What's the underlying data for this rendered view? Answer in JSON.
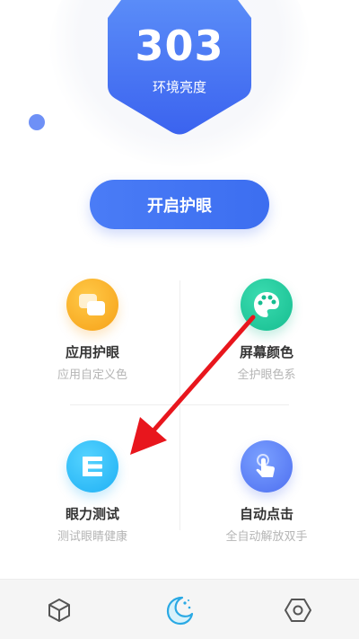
{
  "header": {
    "brightness_value": "303",
    "brightness_label": "环境亮度"
  },
  "main_button": {
    "label": "开启护眼"
  },
  "features": [
    {
      "title": "应用护眼",
      "subtitle": "应用自定义色",
      "icon": "app-eye-icon"
    },
    {
      "title": "屏幕颜色",
      "subtitle": "全护眼色系",
      "icon": "palette-icon"
    },
    {
      "title": "眼力测试",
      "subtitle": "测试眼睛健康",
      "icon": "eye-test-icon"
    },
    {
      "title": "自动点击",
      "subtitle": "全自动解放双手",
      "icon": "tap-hand-icon"
    }
  ],
  "tabs": [
    {
      "icon": "cube-icon",
      "active": false
    },
    {
      "icon": "moon-icon",
      "active": true
    },
    {
      "icon": "hexagon-settings-icon",
      "active": false
    }
  ],
  "colors": {
    "primary": "#4a7cf6",
    "orange": "#f6a118",
    "green": "#16bd90",
    "blue": "#1fb0f4",
    "indigo": "#4e6ff0",
    "annotation_arrow": "#e8161d"
  }
}
